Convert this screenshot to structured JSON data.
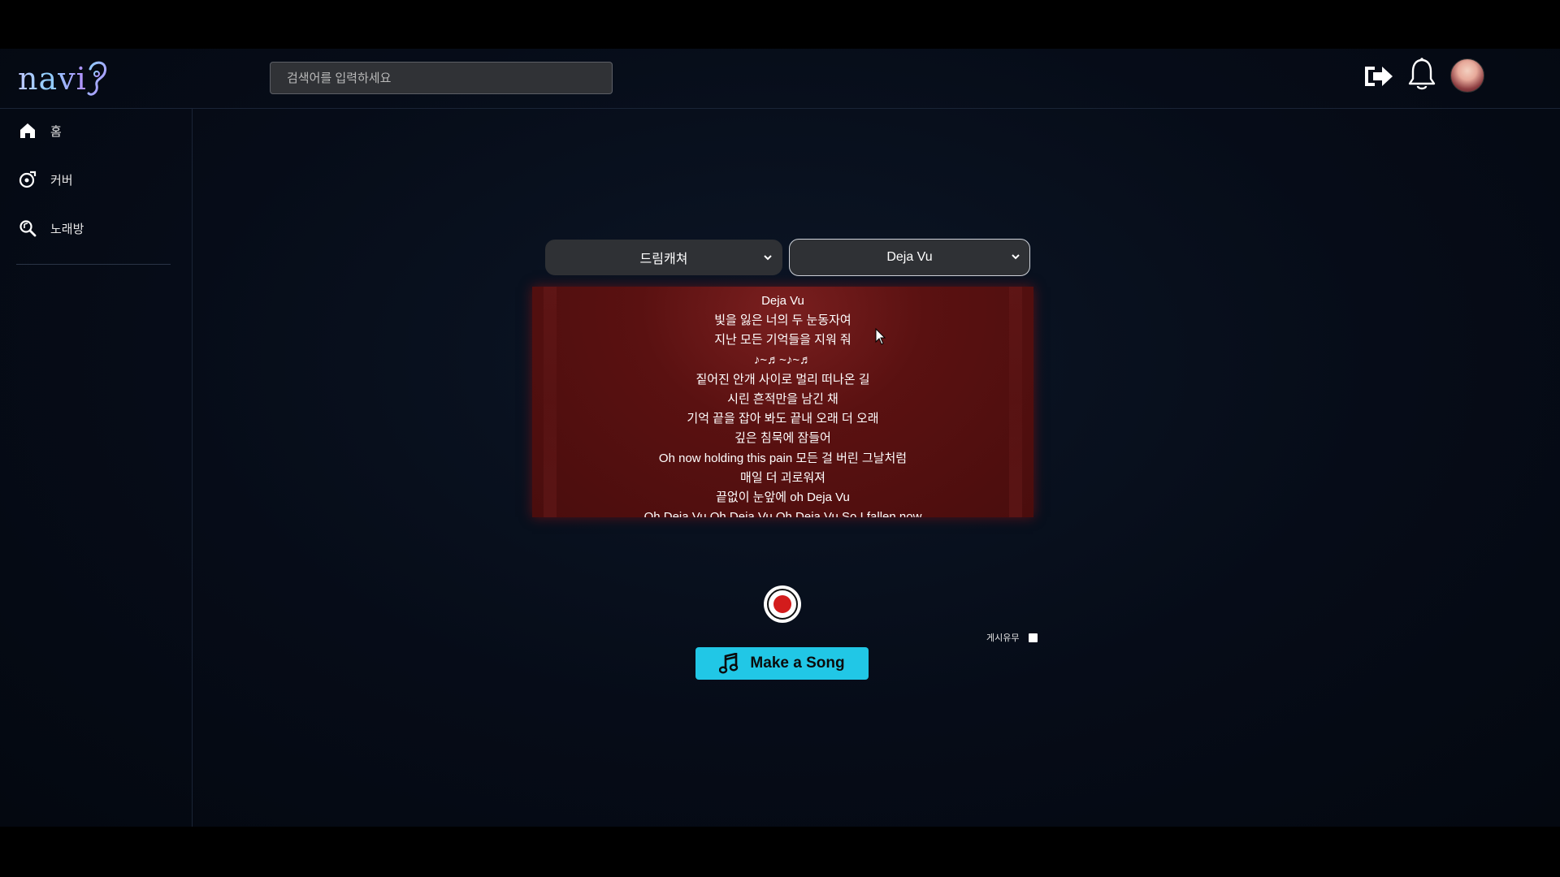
{
  "app": {
    "logo_text": "navi",
    "search_placeholder": "검색어를 입력하세요"
  },
  "header": {
    "icons": [
      "logout-icon",
      "bell-icon",
      "avatar"
    ]
  },
  "sidebar": {
    "items": [
      {
        "label": "홈",
        "icon": "home-icon"
      },
      {
        "label": "커버",
        "icon": "cover-icon"
      },
      {
        "label": "노래방",
        "icon": "karaoke-search-icon"
      }
    ]
  },
  "main": {
    "artist_select": "드림캐쳐",
    "song_select": "Deja Vu",
    "lyrics": [
      "Deja Vu",
      "빛을 잃은 너의 두 눈동자여",
      "지난 모든 기억들을 지워 줘",
      "♪~♬~♪~♬",
      "짙어진 안개 사이로 멀리 떠나온 길",
      "시린 흔적만을 남긴 채",
      "기억 끝을 잡아 봐도 끝내 오래 더 오래",
      "깊은 침묵에 잠들어",
      "Oh now holding this pain 모든 걸 버린 그날처럼",
      "매일 더 괴로워져",
      "끝없이 눈앞에 oh Deja Vu",
      "Oh Deja Vu Oh Deja Vu Oh Deja Vu So I fallen now"
    ],
    "publish_label": "게시유무",
    "publish_checked": false,
    "make_button_label": "Make a Song"
  },
  "colors": {
    "accent": "#21c7e6",
    "lyrics_bg": "#5a1111",
    "record": "#d31c1c"
  }
}
